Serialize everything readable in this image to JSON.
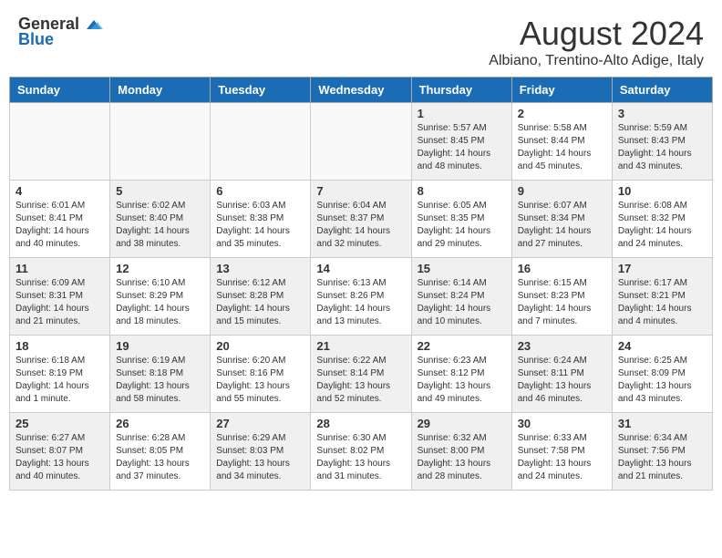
{
  "header": {
    "logo_general": "General",
    "logo_blue": "Blue",
    "month_title": "August 2024",
    "location": "Albiano, Trentino-Alto Adige, Italy"
  },
  "days_of_week": [
    "Sunday",
    "Monday",
    "Tuesday",
    "Wednesday",
    "Thursday",
    "Friday",
    "Saturday"
  ],
  "weeks": [
    [
      {
        "day": "",
        "info": ""
      },
      {
        "day": "",
        "info": ""
      },
      {
        "day": "",
        "info": ""
      },
      {
        "day": "",
        "info": ""
      },
      {
        "day": "1",
        "info": "Sunrise: 5:57 AM\nSunset: 8:45 PM\nDaylight: 14 hours\nand 48 minutes."
      },
      {
        "day": "2",
        "info": "Sunrise: 5:58 AM\nSunset: 8:44 PM\nDaylight: 14 hours\nand 45 minutes."
      },
      {
        "day": "3",
        "info": "Sunrise: 5:59 AM\nSunset: 8:43 PM\nDaylight: 14 hours\nand 43 minutes."
      }
    ],
    [
      {
        "day": "4",
        "info": "Sunrise: 6:01 AM\nSunset: 8:41 PM\nDaylight: 14 hours\nand 40 minutes."
      },
      {
        "day": "5",
        "info": "Sunrise: 6:02 AM\nSunset: 8:40 PM\nDaylight: 14 hours\nand 38 minutes."
      },
      {
        "day": "6",
        "info": "Sunrise: 6:03 AM\nSunset: 8:38 PM\nDaylight: 14 hours\nand 35 minutes."
      },
      {
        "day": "7",
        "info": "Sunrise: 6:04 AM\nSunset: 8:37 PM\nDaylight: 14 hours\nand 32 minutes."
      },
      {
        "day": "8",
        "info": "Sunrise: 6:05 AM\nSunset: 8:35 PM\nDaylight: 14 hours\nand 29 minutes."
      },
      {
        "day": "9",
        "info": "Sunrise: 6:07 AM\nSunset: 8:34 PM\nDaylight: 14 hours\nand 27 minutes."
      },
      {
        "day": "10",
        "info": "Sunrise: 6:08 AM\nSunset: 8:32 PM\nDaylight: 14 hours\nand 24 minutes."
      }
    ],
    [
      {
        "day": "11",
        "info": "Sunrise: 6:09 AM\nSunset: 8:31 PM\nDaylight: 14 hours\nand 21 minutes."
      },
      {
        "day": "12",
        "info": "Sunrise: 6:10 AM\nSunset: 8:29 PM\nDaylight: 14 hours\nand 18 minutes."
      },
      {
        "day": "13",
        "info": "Sunrise: 6:12 AM\nSunset: 8:28 PM\nDaylight: 14 hours\nand 15 minutes."
      },
      {
        "day": "14",
        "info": "Sunrise: 6:13 AM\nSunset: 8:26 PM\nDaylight: 14 hours\nand 13 minutes."
      },
      {
        "day": "15",
        "info": "Sunrise: 6:14 AM\nSunset: 8:24 PM\nDaylight: 14 hours\nand 10 minutes."
      },
      {
        "day": "16",
        "info": "Sunrise: 6:15 AM\nSunset: 8:23 PM\nDaylight: 14 hours\nand 7 minutes."
      },
      {
        "day": "17",
        "info": "Sunrise: 6:17 AM\nSunset: 8:21 PM\nDaylight: 14 hours\nand 4 minutes."
      }
    ],
    [
      {
        "day": "18",
        "info": "Sunrise: 6:18 AM\nSunset: 8:19 PM\nDaylight: 14 hours\nand 1 minute."
      },
      {
        "day": "19",
        "info": "Sunrise: 6:19 AM\nSunset: 8:18 PM\nDaylight: 13 hours\nand 58 minutes."
      },
      {
        "day": "20",
        "info": "Sunrise: 6:20 AM\nSunset: 8:16 PM\nDaylight: 13 hours\nand 55 minutes."
      },
      {
        "day": "21",
        "info": "Sunrise: 6:22 AM\nSunset: 8:14 PM\nDaylight: 13 hours\nand 52 minutes."
      },
      {
        "day": "22",
        "info": "Sunrise: 6:23 AM\nSunset: 8:12 PM\nDaylight: 13 hours\nand 49 minutes."
      },
      {
        "day": "23",
        "info": "Sunrise: 6:24 AM\nSunset: 8:11 PM\nDaylight: 13 hours\nand 46 minutes."
      },
      {
        "day": "24",
        "info": "Sunrise: 6:25 AM\nSunset: 8:09 PM\nDaylight: 13 hours\nand 43 minutes."
      }
    ],
    [
      {
        "day": "25",
        "info": "Sunrise: 6:27 AM\nSunset: 8:07 PM\nDaylight: 13 hours\nand 40 minutes."
      },
      {
        "day": "26",
        "info": "Sunrise: 6:28 AM\nSunset: 8:05 PM\nDaylight: 13 hours\nand 37 minutes."
      },
      {
        "day": "27",
        "info": "Sunrise: 6:29 AM\nSunset: 8:03 PM\nDaylight: 13 hours\nand 34 minutes."
      },
      {
        "day": "28",
        "info": "Sunrise: 6:30 AM\nSunset: 8:02 PM\nDaylight: 13 hours\nand 31 minutes."
      },
      {
        "day": "29",
        "info": "Sunrise: 6:32 AM\nSunset: 8:00 PM\nDaylight: 13 hours\nand 28 minutes."
      },
      {
        "day": "30",
        "info": "Sunrise: 6:33 AM\nSunset: 7:58 PM\nDaylight: 13 hours\nand 24 minutes."
      },
      {
        "day": "31",
        "info": "Sunrise: 6:34 AM\nSunset: 7:56 PM\nDaylight: 13 hours\nand 21 minutes."
      }
    ]
  ]
}
